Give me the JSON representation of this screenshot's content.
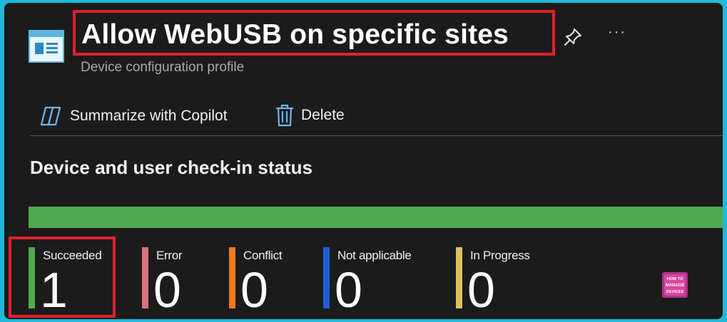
{
  "header": {
    "title": "Allow WebUSB on specific sites",
    "subtitle": "Device configuration profile",
    "more_label": "···"
  },
  "commands": [
    {
      "label": "Summarize with Copilot",
      "icon": "copilot-icon"
    },
    {
      "label": "Delete",
      "icon": "trash-icon"
    }
  ],
  "section": {
    "title": "Device and user check-in status"
  },
  "progress": {
    "succeeded_fraction": 1.0,
    "color": "#4faa4f"
  },
  "stats": [
    {
      "label": "Succeeded",
      "value": "1",
      "color": "#4faa4f"
    },
    {
      "label": "Error",
      "value": "0",
      "color": "#d9737d"
    },
    {
      "label": "Conflict",
      "value": "0",
      "color": "#f07a1e"
    },
    {
      "label": "Not applicable",
      "value": "0",
      "color": "#1f5fd6"
    },
    {
      "label": "In Progress",
      "value": "0",
      "color": "#dcc05a"
    }
  ],
  "watermark": {
    "line1": "HOW TO",
    "line2": "MANAGE",
    "line3": "DEVICES"
  }
}
